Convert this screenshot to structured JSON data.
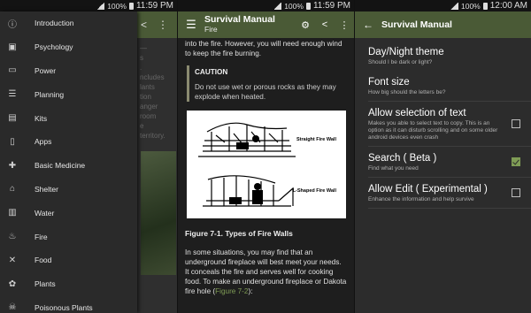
{
  "status": {
    "s1": {
      "battery": "100%",
      "time": "11:59 PM"
    },
    "s2": {
      "battery": "100%",
      "time": "11:59 PM"
    },
    "s3": {
      "battery": "100%",
      "time": "12:00 AM"
    }
  },
  "drawer": {
    "items": [
      {
        "label": "Introduction",
        "icon": "info-icon"
      },
      {
        "label": "Psychology",
        "icon": "contact-card-icon"
      },
      {
        "label": "Power",
        "icon": "battery-icon"
      },
      {
        "label": "Planning",
        "icon": "list-icon"
      },
      {
        "label": "Kits",
        "icon": "briefcase-icon"
      },
      {
        "label": "Apps",
        "icon": "phone-icon"
      },
      {
        "label": "Basic Medicine",
        "icon": "bandage-icon"
      },
      {
        "label": "Shelter",
        "icon": "store-icon"
      },
      {
        "label": "Water",
        "icon": "water-icon"
      },
      {
        "label": "Fire",
        "icon": "fire-icon"
      },
      {
        "label": "Food",
        "icon": "utensils-icon"
      },
      {
        "label": "Plants",
        "icon": "flower-icon"
      },
      {
        "label": "Poisonous Plants",
        "icon": "skull-icon"
      }
    ]
  },
  "article": {
    "app_title": "Survival Manual",
    "section": "Fire",
    "intro_tail": "into the fire. However, you will need enough wind to keep the fire burning.",
    "caution_title": "CAUTION",
    "caution_text": "Do not use wet or porous rocks as they may explode when heated.",
    "figure_labels": [
      "Straight Fire Wall",
      "L-Shaped Fire Wall"
    ],
    "figure_caption": "Figure 7-1. Types of Fire Walls",
    "body_text": "In some situations, you may find that an underground fireplace will best meet your needs. It conceals the fire and serves well for cooking food. To make an underground fireplace or Dakota fire hole (",
    "body_link": "Figure 7-2",
    "body_end": "):"
  },
  "settings": {
    "title": "Survival Manual",
    "prefs": [
      {
        "title": "Day/Night theme",
        "summary": "Should I be dark or light?",
        "checkbox": null
      },
      {
        "title": "Font size",
        "summary": "How big should the letters be?",
        "checkbox": null
      },
      {
        "title": "Allow selection of text",
        "summary": "Makes you able to select text to copy. This is an option as it can disturb scrolling and on some older android devices even crash",
        "checkbox": false
      },
      {
        "title": "Search ( Beta )",
        "summary": "Find what you need",
        "checkbox": true
      },
      {
        "title": "Allow Edit ( Experimental )",
        "summary": "Enhance the information and help survive",
        "checkbox": false
      }
    ]
  }
}
